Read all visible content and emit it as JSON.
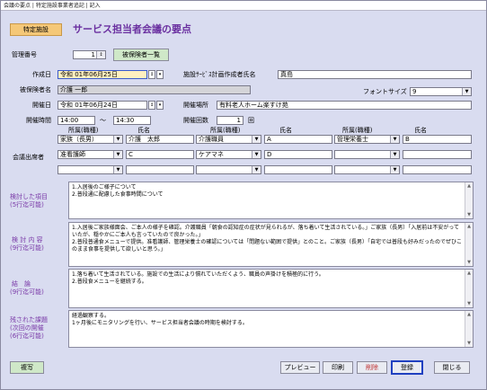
{
  "window": {
    "title": "会議の要点 | 特定施設事業者追記 | 記入"
  },
  "header": {
    "tag": "特定施設",
    "title": "サービス担当者会議の要点"
  },
  "top": {
    "kanri_label": "管理番号",
    "kanri_value": "1",
    "list_button": "被保険者一覧"
  },
  "form": {
    "sakusei_label": "作成日",
    "sakusei_value": "令和 01年06月25日",
    "sakuseisha_label": "施設ｻｰﾋﾞｽ計画作成者氏名",
    "sakuseisha_value": "真島",
    "hihoken_label": "被保険者名",
    "hihoken_value": "介護 一郎",
    "font_label": "フォントサイズ",
    "font_value": "9",
    "kaisai_label": "開催日",
    "kaisai_value": "令和 01年06月24日",
    "basho_label": "開催場所",
    "basho_value": "有料老人ホーム楽すけ苑",
    "jikan_label": "開催時間",
    "jikan_start": "14:00",
    "jikan_tilde": "～",
    "jikan_end": "14:30",
    "kaisu_label": "開催回数",
    "kaisu_value": "1",
    "kaisu_unit": "回",
    "attendees_label": "会議出席者",
    "col_header_1": "所属(職種)",
    "col_header_2": "氏名",
    "attendees": [
      [
        {
          "org": "家族（長男）",
          "name": "介護　太郎"
        },
        {
          "org": "介護職員",
          "name": "A"
        },
        {
          "org": "管理栄養士",
          "name": "B"
        }
      ],
      [
        {
          "org": "准看護師",
          "name": "C"
        },
        {
          "org": "ケアマネ",
          "name": "D"
        },
        {
          "org": "",
          "name": ""
        }
      ],
      [
        {
          "org": "",
          "name": ""
        },
        {
          "org": "",
          "name": ""
        },
        {
          "org": "",
          "name": ""
        }
      ]
    ]
  },
  "sections": {
    "kentou_label_1": "検討した項目",
    "kentou_label_2": "(5行迄可能)",
    "kentou_text": "1.入居後のご様子について\n2.普段通に配慮した食事時間について",
    "naiyou_label_1": "検 討 内 容",
    "naiyou_label_2": "(9行迄可能)",
    "naiyou_text": "1.入居後ご家族様面会、ご本人の様子を確認。介護職員「朝食の認知症の症状が見られるが、落ち着いて生活されている。」ご家族（長男）「入居前は不安がっていたが、穏やかにご本人も言っていたので良かった。」\n2.普段普通食メニューで提供。准看護師、管理栄養士の確認については「問題ない範囲で提供」とのこと。ご家族（長男）「自宅では普段も好みだったのでぜひこのまま食事を提供して欲しいと思う。」",
    "ketsuron_label_1": "結　論",
    "ketsuron_label_2": "(9行迄可能)",
    "ketsuron_text": "1.落ち着いて生活されている。施設での生活により慣れていただくよう、職員の声掛けを積極的に行う。\n2.普段食メニューを継続する。",
    "kadai_label_1": "残された課題",
    "kadai_label_2": "(次回の開催",
    "kadai_label_3": "(6行迄可能)",
    "kadai_text": "経過観察する。\n1ヶ月後にモニタリングを行い、サービス担当者会議の時期を検討する。"
  },
  "buttons": {
    "copy": "複写",
    "preview": "プレビュー",
    "print": "印刷",
    "delete": "削除",
    "register": "登録",
    "close": "閉じる"
  },
  "colors": {
    "background": "#d9dcf0",
    "title_purple": "#6a2fa0",
    "section_purple": "#7a3aa8",
    "tag_orange": "#f5c878",
    "highlight_field": "#fff0c0",
    "button_green": "#cfe8c8"
  }
}
